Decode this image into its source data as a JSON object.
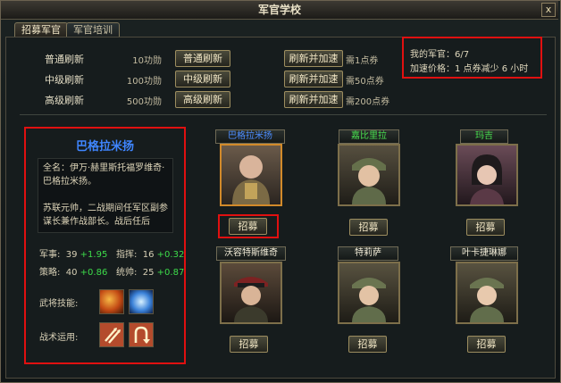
{
  "window": {
    "title": "军官学校",
    "close_label": "x"
  },
  "tabs": [
    {
      "label": "招募军官"
    },
    {
      "label": "军官培训"
    }
  ],
  "refresh": [
    {
      "label": "普通刷新",
      "cost": "10功勋",
      "button": "普通刷新",
      "speed_button": "刷新并加速",
      "tickets": "需1点券"
    },
    {
      "label": "中级刷新",
      "cost": "100功勋",
      "button": "中级刷新",
      "speed_button": "刷新并加速",
      "tickets": "需50点券"
    },
    {
      "label": "高级刷新",
      "cost": "500功勋",
      "button": "高级刷新",
      "speed_button": "刷新并加速",
      "tickets": "需200点券"
    }
  ],
  "info": {
    "my_officers": "我的军官：6/7",
    "speed_price": "加速价格：1 点券减少 6 小时"
  },
  "detail": {
    "name": "巴格拉米扬",
    "description": "全名：伊万·赫里斯托福罗维奇·巴格拉米扬。\n\n苏联元帅，二战期间任军区副参谋长兼作战部长。战后任后",
    "stats": [
      {
        "label": "军事:",
        "base": "39",
        "bonus": "+1.95"
      },
      {
        "label": "指挥:",
        "base": "16",
        "bonus": "+0.32"
      },
      {
        "label": "策略:",
        "base": "40",
        "bonus": "+0.86"
      },
      {
        "label": "统帅:",
        "base": "25",
        "bonus": "+0.87"
      }
    ],
    "skills_label": "武将技能:",
    "tactics_label": "战术运用:"
  },
  "officers": [
    {
      "name": "巴格拉米扬",
      "name_color": "#4d8dff",
      "recruit": "招募"
    },
    {
      "name": "嘉比里拉",
      "name_color": "#49e04f",
      "recruit": "招募"
    },
    {
      "name": "玛吉",
      "name_color": "#49e04f",
      "recruit": "招募"
    },
    {
      "name": "沃容特斯维奇",
      "name_color": "#f0ead6",
      "recruit": "招募"
    },
    {
      "name": "特莉萨",
      "name_color": "#f0ead6",
      "recruit": "招募"
    },
    {
      "name": "叶卡捷琳娜",
      "name_color": "#f0ead6",
      "recruit": "招募"
    }
  ]
}
